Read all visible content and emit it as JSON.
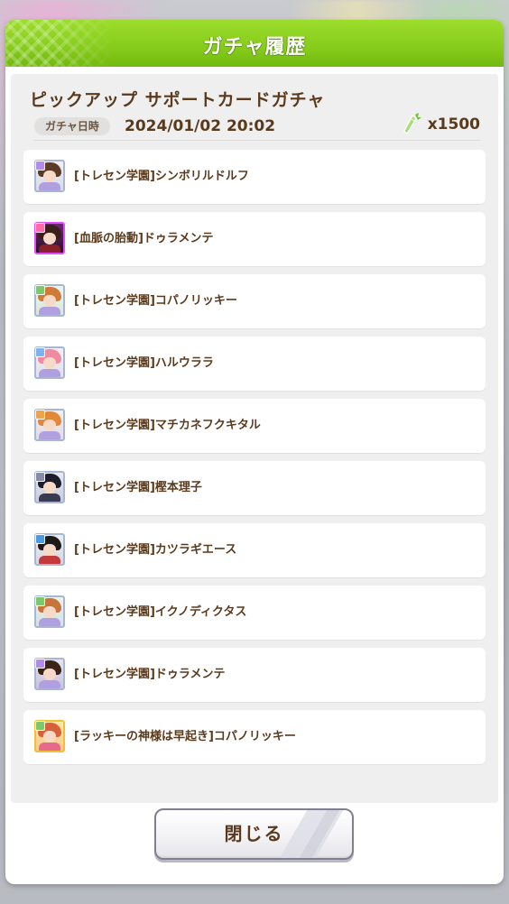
{
  "dialog": {
    "title": "ガチャ履歴",
    "banner_name": "ピックアップ サポートカードガチャ",
    "date_label": "ガチャ日時",
    "date_value": "2024/01/02 20:02",
    "cost": "x1500",
    "cost_icon": "carrot-jewel-icon",
    "close_label": "閉じる"
  },
  "colors": {
    "header_green": "#86cc1c",
    "text_brown": "#5a3a1c",
    "rainbow_frame": "#e24cff"
  },
  "results": [
    {
      "name": "[トレセン学園]シンボリルドルフ",
      "rarity": "R"
    },
    {
      "name": "[血脈の胎動]ドゥラメンテ",
      "rarity": "SSR"
    },
    {
      "name": "[トレセン学園]コパノリッキー",
      "rarity": "R"
    },
    {
      "name": "[トレセン学園]ハルウララ",
      "rarity": "R"
    },
    {
      "name": "[トレセン学園]マチカネフクキタル",
      "rarity": "R"
    },
    {
      "name": "[トレセン学園]樫本理子",
      "rarity": "R"
    },
    {
      "name": "[トレセン学園]カツラギエース",
      "rarity": "R"
    },
    {
      "name": "[トレセン学園]イクノディクタス",
      "rarity": "R"
    },
    {
      "name": "[トレセン学園]ドゥラメンテ",
      "rarity": "R"
    },
    {
      "name": "[ラッキーの神様は早起き]コパノリッキー",
      "rarity": "SR"
    }
  ]
}
